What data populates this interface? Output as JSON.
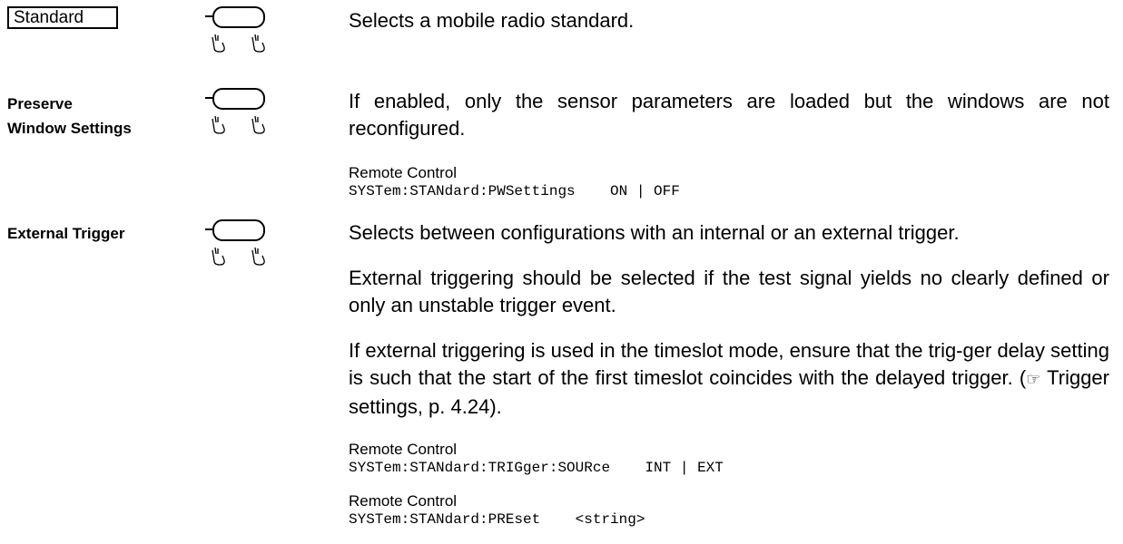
{
  "standard": {
    "label": "Standard",
    "description": "Selects a mobile radio standard."
  },
  "preserve": {
    "label_line1": "Preserve",
    "label_line2": "Window Settings",
    "description": "If enabled, only the sensor parameters are loaded but the windows are not reconfigured.",
    "remote_label": "Remote Control",
    "remote_cmd": "SYSTem:STANdard:PWSettings",
    "remote_args": "ON | OFF"
  },
  "external_trigger": {
    "label": "External Trigger",
    "para1": "Selects between configurations with an internal or an external trigger.",
    "para2": "External triggering should be selected if the test signal yields no clearly defined or only an unstable trigger event.",
    "para3_before": "If external triggering is used in the timeslot mode, ensure that the trig-ger delay setting is such that the start of the first timeslot coincides with the delayed trigger. (",
    "pointer_icon": "☞",
    "para3_after": " Trigger settings, p. 4.24).",
    "remote1_label": "Remote Control",
    "remote1_cmd": "SYSTem:STANdard:TRIGger:SOURce",
    "remote1_args": "INT | EXT",
    "remote2_label": "Remote Control",
    "remote2_cmd": "SYSTem:STANdard:PREset",
    "remote2_args": "<string>"
  }
}
